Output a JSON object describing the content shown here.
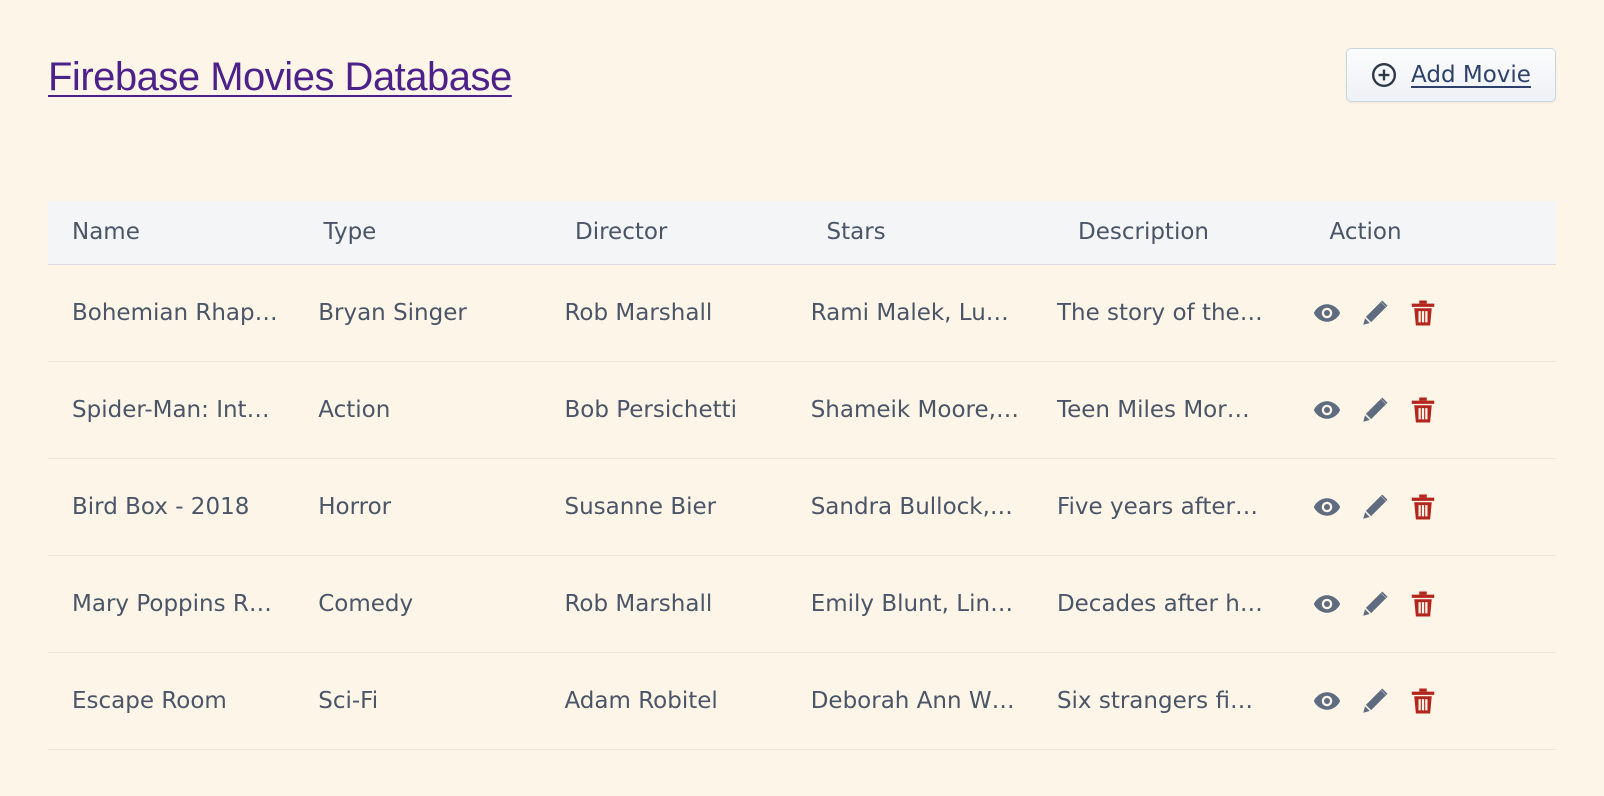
{
  "header": {
    "title": "Firebase Movies Database",
    "add_button_label": "Add Movie"
  },
  "table": {
    "columns": [
      "Name",
      "Type",
      "Director",
      "Stars",
      "Description",
      "Action"
    ],
    "rows": [
      {
        "name": "Bohemian Rhap…",
        "type": "Bryan Singer",
        "director": "Rob Marshall",
        "stars": "Rami Malek, Lu…",
        "description": "The story of the…"
      },
      {
        "name": "Spider-Man: Int…",
        "type": "Action",
        "director": "Bob Persichetti",
        "stars": "Shameik Moore,…",
        "description": "Teen Miles Mor…"
      },
      {
        "name": "Bird Box - 2018",
        "type": "Horror",
        "director": "Susanne Bier",
        "stars": "Sandra Bullock, …",
        "description": "Five years after …"
      },
      {
        "name": "Mary Poppins R…",
        "type": "Comedy",
        "director": "Rob Marshall",
        "stars": "Emily Blunt, Lin…",
        "description": "Decades after h…"
      },
      {
        "name": "Escape Room",
        "type": "Sci-Fi",
        "director": "Adam Robitel",
        "stars": "Deborah Ann W…",
        "description": "Six strangers fin…"
      }
    ],
    "action_icons": [
      "eye-icon",
      "pencil-icon",
      "trash-icon"
    ]
  },
  "colors": {
    "background": "#fdf6e8",
    "title": "#4c2189",
    "view_icon": "#5f6c80",
    "edit_icon": "#5f6c80",
    "delete_icon": "#b3261e"
  }
}
